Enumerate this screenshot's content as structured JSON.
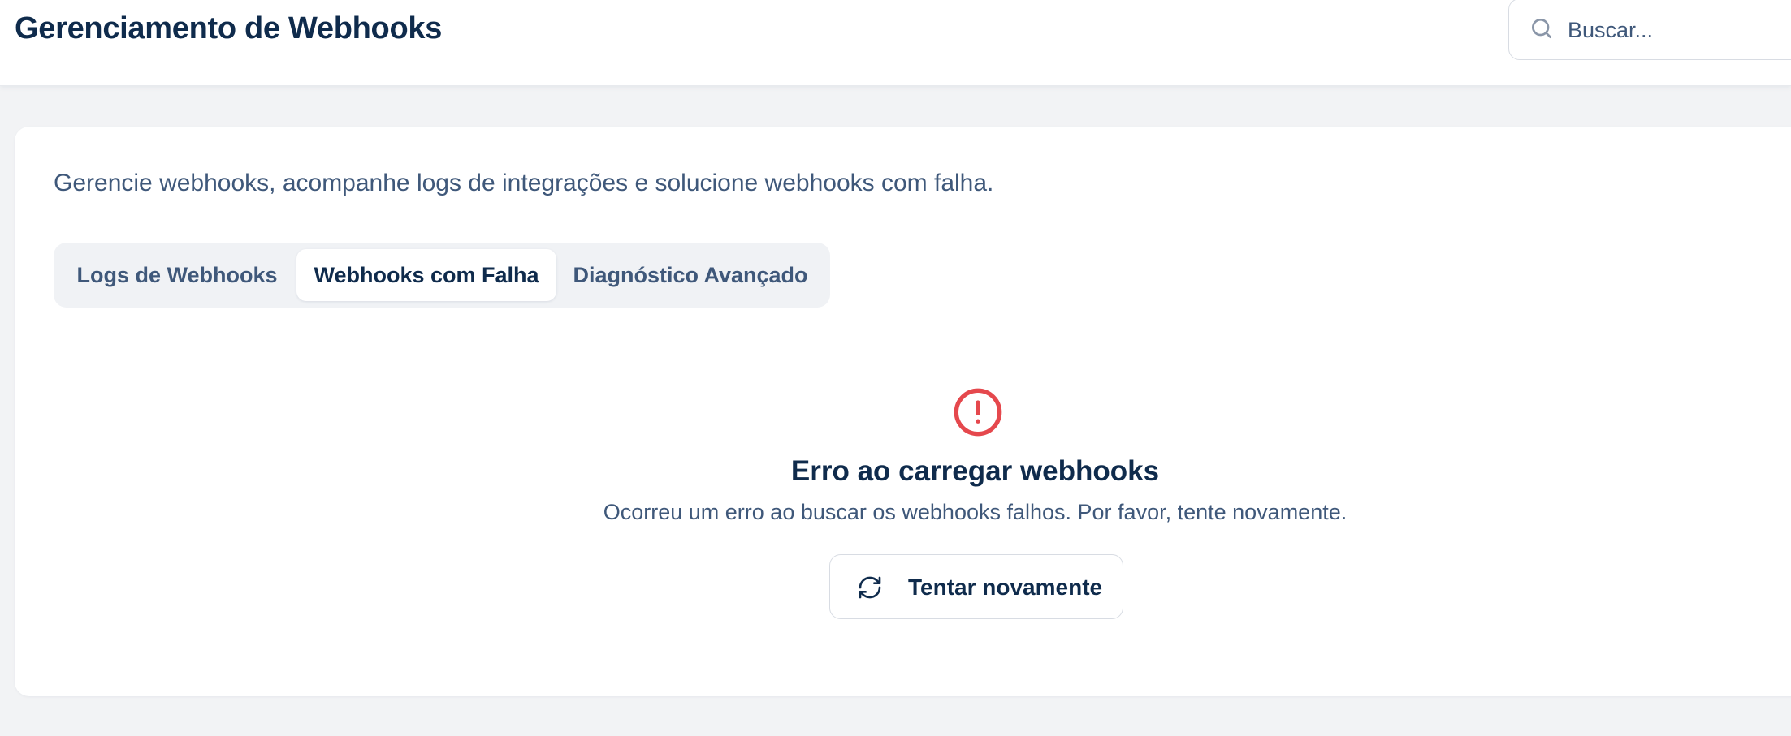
{
  "header": {
    "title": "Gerenciamento de Webhooks",
    "search": {
      "placeholder": "Buscar...",
      "value": "",
      "icon": "search-icon"
    }
  },
  "main": {
    "subtitle": "Gerencie webhooks, acompanhe logs de integrações e solucione webhooks com falha.",
    "tabs": [
      {
        "label": "Logs de Webhooks",
        "active": false
      },
      {
        "label": "Webhooks com Falha",
        "active": true
      },
      {
        "label": "Diagnóstico Avançado",
        "active": false
      }
    ],
    "error": {
      "icon": "alert-circle-icon",
      "title": "Erro ao carregar webhooks",
      "message": "Ocorreu um erro ao buscar os webhooks falhos. Por favor, tente novamente.",
      "retry_label": "Tentar novamente",
      "retry_icon": "refresh-icon"
    }
  },
  "colors": {
    "primary_text": "#0f2b4c",
    "secondary_text": "#3f587a",
    "error": "#e5484d",
    "background": "#f2f3f5",
    "surface": "#ffffff"
  }
}
